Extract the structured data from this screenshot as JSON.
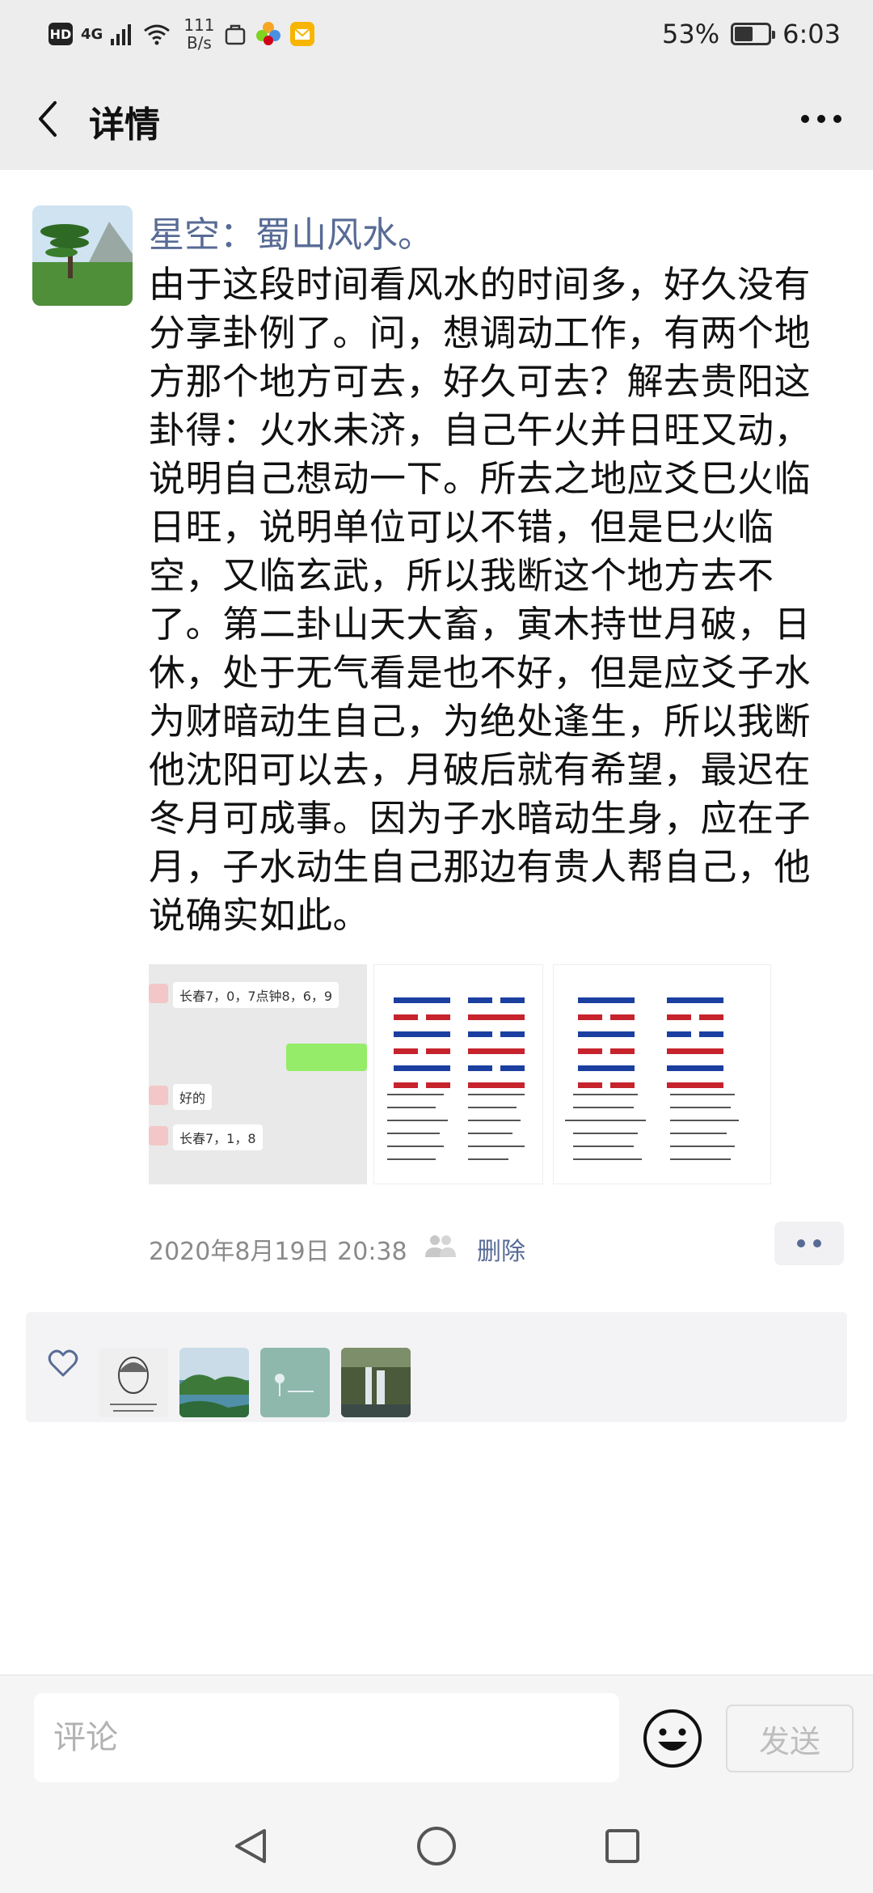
{
  "status_bar": {
    "hd": "HD",
    "network": "4G",
    "speed_value": "111",
    "speed_unit": "B/s",
    "battery": "53%",
    "battery_level": 0.53,
    "time": "6:03"
  },
  "header": {
    "title": "详情",
    "back_icon": "chevron-left-icon",
    "more_icon": "more-dots-icon"
  },
  "post": {
    "username": "星空：蜀山风水。",
    "text": "由于这段时间看风水的时间多，好久没有分享卦例了。问，想调动工作，有两个地方那个地方可去，好久可去？解去贵阳这卦得：火水未济，自己午火并日旺又动，说明自己想动一下。所去之地应爻巳火临日旺，说明单位可以不错，但是巳火临空，又临玄武，所以我断这个地方去不了。第二卦山天大畜，寅木持世月破，日休，处于无气看是也不好，但是应爻子水为财暗动生自己，为绝处逢生，所以我断他沈阳可以去，月破后就有希望，最迟在冬月可成事。因为子水暗动生身，应在子月，子水动生自己那边有贵人帮自己，他说确实如此。",
    "images": {
      "chat": {
        "msg1": "长春7，0，7点钟8，6，9",
        "msg2": "好的",
        "msg3": "长春7，1，8"
      }
    },
    "timestamp": "2020年8月19日 20:38",
    "delete_label": "删除"
  },
  "likes": {
    "count": 4
  },
  "comment_bar": {
    "placeholder": "评论",
    "send_label": "发送"
  },
  "colors": {
    "link": "#576b95",
    "background": "#ededed"
  }
}
